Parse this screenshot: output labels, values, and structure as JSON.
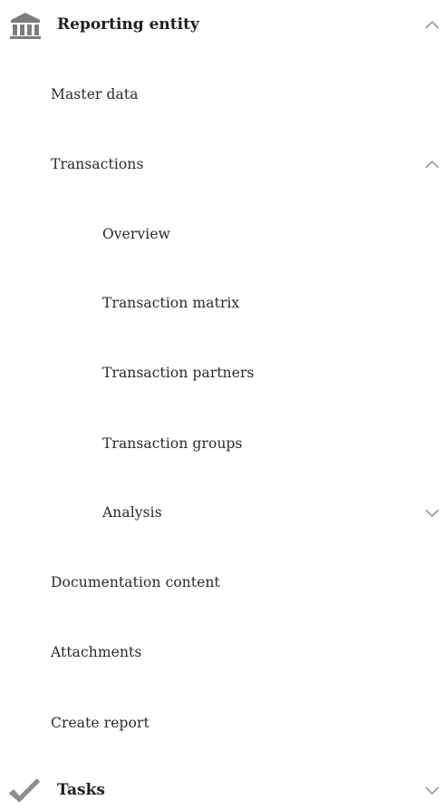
{
  "nav": {
    "reporting_entity": {
      "title": "Reporting entity",
      "icon": "bank-building-icon",
      "expanded": true,
      "items": {
        "master_data": "Master data",
        "transactions": {
          "label": "Transactions",
          "expanded": true,
          "children": {
            "overview": "Overview",
            "transaction_matrix": "Transaction matrix",
            "transaction_partners": "Transaction partners",
            "transaction_groups": "Transaction groups",
            "analysis": "Analysis"
          }
        },
        "documentation_content": "Documentation content",
        "attachments": "Attachments",
        "create_report": "Create report"
      }
    },
    "tasks": {
      "title": "Tasks",
      "icon": "checkmark-icon",
      "expanded": false
    }
  },
  "colors": {
    "icon_gray": "#7d7d7d",
    "checkmark_gray": "#8a8f8c",
    "chevron_gray": "#9a9a9a",
    "text": "#222222"
  }
}
